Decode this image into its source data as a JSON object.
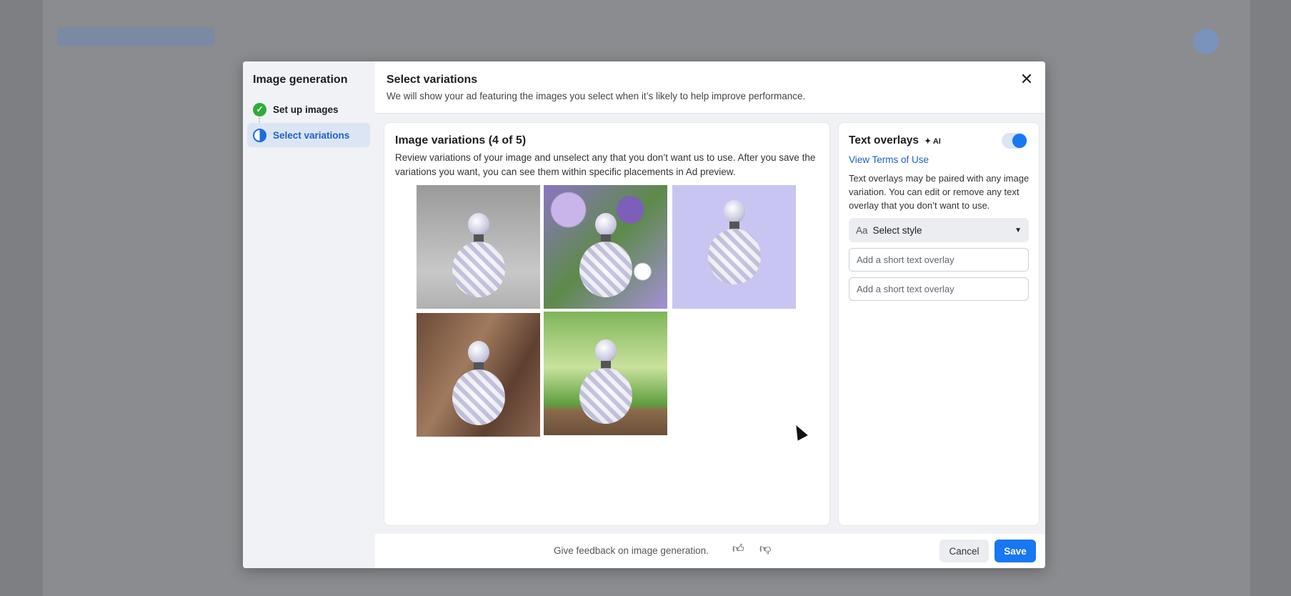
{
  "sidebar": {
    "title": "Image generation",
    "steps": [
      {
        "label": "Set up images",
        "status": "complete"
      },
      {
        "label": "Select variations",
        "status": "in-progress"
      }
    ]
  },
  "header": {
    "title": "Select variations",
    "subtitle": "We will show your ad featuring the images you select when it’s likely to help improve performance."
  },
  "variations": {
    "title": "Image variations (4 of 5)",
    "description": "Review variations of your image and unselect any that you don’t want us to use. After you save the variations you want, you can see them within specific placements in Ad preview.",
    "images": [
      {
        "background": "gray studio with white flower"
      },
      {
        "background": "purple and white flowers"
      },
      {
        "background": "lavender solid"
      },
      {
        "background": "wooden table"
      },
      {
        "background": "green bokeh on wooden shelf"
      }
    ]
  },
  "overlays": {
    "title": "Text overlays",
    "ai_badge": "AI",
    "enabled": true,
    "terms_link": "View Terms of Use",
    "description": "Text overlays may be paired with any image variation. You can edit or remove any text overlay that you don’t want to use.",
    "style_prefix": "Aa",
    "style_select": "Select style",
    "input_placeholder_1": "Add a short text overlay",
    "input_placeholder_2": "Add a short text overlay"
  },
  "footer": {
    "feedback": "Give feedback on image generation.",
    "cancel": "Cancel",
    "save": "Save"
  },
  "colors": {
    "accent": "#1877f2",
    "success": "#2eab3b"
  }
}
